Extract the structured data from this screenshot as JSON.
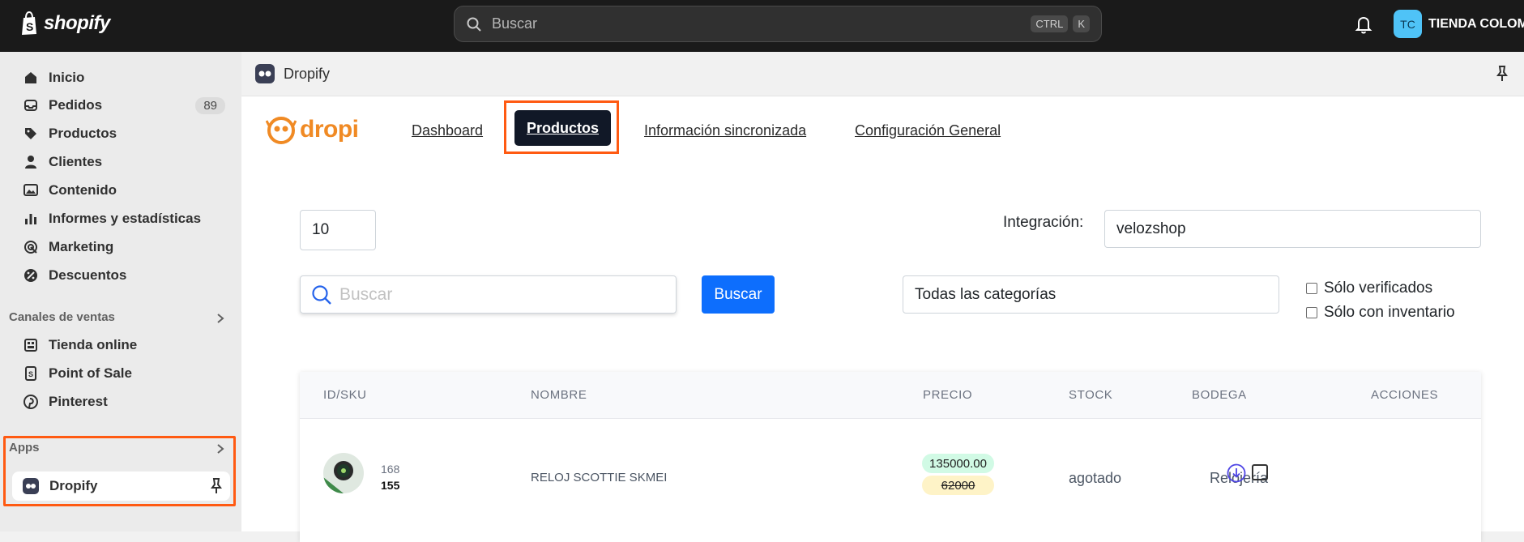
{
  "topbar": {
    "brand": "shopify",
    "search_placeholder": "Buscar",
    "shortcut_ctrl": "CTRL",
    "shortcut_key": "K",
    "avatar_initials": "TC",
    "store_name": "TIENDA COLOMBIA"
  },
  "sidebar": {
    "items": [
      {
        "label": "Inicio",
        "icon": "home-icon"
      },
      {
        "label": "Pedidos",
        "icon": "inbox-icon",
        "badge": "89"
      },
      {
        "label": "Productos",
        "icon": "tag-icon"
      },
      {
        "label": "Clientes",
        "icon": "person-icon"
      },
      {
        "label": "Contenido",
        "icon": "image-icon"
      },
      {
        "label": "Informes y estadísticas",
        "icon": "bar-chart-icon"
      },
      {
        "label": "Marketing",
        "icon": "target-icon"
      },
      {
        "label": "Descuentos",
        "icon": "discount-icon"
      }
    ],
    "sales_channels_label": "Canales de ventas",
    "channels": [
      {
        "label": "Tienda online",
        "icon": "store-icon"
      },
      {
        "label": "Point of Sale",
        "icon": "pos-icon"
      },
      {
        "label": "Pinterest",
        "icon": "pinterest-icon"
      }
    ],
    "apps_label": "Apps",
    "app_item": "Dropify"
  },
  "app_header": {
    "title": "Dropify"
  },
  "app": {
    "logo_text": "dropi",
    "tabs": {
      "dashboard": "Dashboard",
      "productos": "Productos",
      "info": "Información sincronizada",
      "config": "Configuración General"
    },
    "page_size": "10",
    "integration_label": "Integración:",
    "integration_value": "velozshop",
    "search_placeholder": "Buscar",
    "search_button": "Buscar",
    "category_select": "Todas las categorías",
    "only_verified": "Sólo verificados",
    "only_inventory": "Sólo con inventario"
  },
  "table": {
    "headers": {
      "id": "ID/SKU",
      "name": "NOMBRE",
      "price": "PRECIO",
      "stock": "STOCK",
      "warehouse": "BODEGA",
      "actions": "ACCIONES"
    },
    "rows": [
      {
        "id": "168",
        "sku": "155",
        "name": "RELOJ SCOTTIE SKMEI",
        "price": "135000.00",
        "old_price": "62000",
        "stock": "agotado",
        "warehouse": "Relojería"
      }
    ]
  },
  "colors": {
    "accent_highlight": "#ff5a12",
    "primary_button": "#0d6efd",
    "active_tab": "#111827",
    "dropi_orange": "#f08a24"
  }
}
